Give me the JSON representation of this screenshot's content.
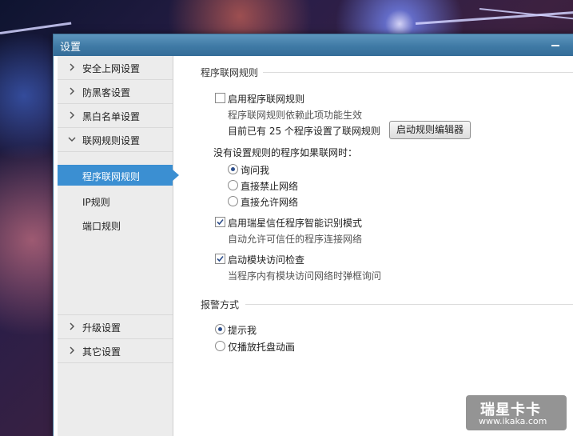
{
  "window": {
    "title": "设置"
  },
  "sidebar": {
    "items": [
      {
        "label": "安全上网设置",
        "expanded": false
      },
      {
        "label": "防黑客设置",
        "expanded": false
      },
      {
        "label": "黑白名单设置",
        "expanded": false
      },
      {
        "label": "联网规则设置",
        "expanded": true
      }
    ],
    "sub_items": [
      {
        "label": "程序联网规则",
        "active": true
      },
      {
        "label": "IP规则",
        "active": false
      },
      {
        "label": "端口规则",
        "active": false
      }
    ],
    "bottom_items": [
      {
        "label": "升级设置",
        "expanded": false
      },
      {
        "label": "其它设置",
        "expanded": false
      }
    ]
  },
  "content": {
    "section1_title": "程序联网规则",
    "enable_rules": {
      "label": "启用程序联网规则",
      "checked": false
    },
    "enable_rules_hint": "程序联网规则依赖此项功能生效",
    "rules_count_text": "目前已有 25 个程序设置了联网规则",
    "editor_button": "启动规则编辑器",
    "no_rule_prompt": "没有设置规则的程序如果联网时：",
    "no_rule_options": [
      {
        "label": "询问我",
        "checked": true
      },
      {
        "label": "直接禁止网络",
        "checked": false
      },
      {
        "label": "直接允许网络",
        "checked": false
      }
    ],
    "smart_mode": {
      "label": "启用瑞星信任程序智能识别模式",
      "checked": true
    },
    "smart_mode_hint": "自动允许可信任的程序连接网络",
    "module_check": {
      "label": "启动模块访问检查",
      "checked": true
    },
    "module_check_hint": "当程序内有模块访问网络时弹框询问",
    "section2_title": "报警方式",
    "alert_options": [
      {
        "label": "提示我",
        "checked": true
      },
      {
        "label": "仅播放托盘动画",
        "checked": false
      }
    ]
  },
  "watermark": {
    "main": "瑞星卡卡",
    "sub": "www.ikaka.com"
  },
  "colors": {
    "accent": "#3b8fd2",
    "titlebar": "#3f7aa5",
    "sidebar_bg": "#ececec"
  }
}
